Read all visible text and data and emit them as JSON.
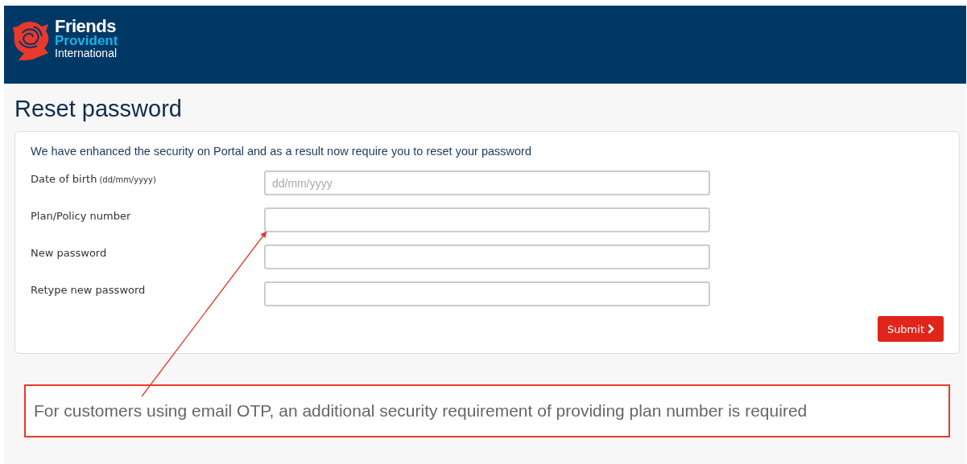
{
  "header": {
    "logo": {
      "line_1": "Friends",
      "line_2": "Provident",
      "line_3": "International"
    }
  },
  "page_title": "Reset password",
  "form": {
    "intro": "We have enhanced the security on Portal and as a result now require you to reset your password",
    "fields": [
      {
        "label": "Date of birth",
        "hint": "(dd/mm/yyyy)",
        "placeholder": "dd/mm/yyyy"
      },
      {
        "label": "Plan/Policy number"
      },
      {
        "label": "New password"
      },
      {
        "label": "Retype new password"
      }
    ],
    "submit": "Submit"
  },
  "annotation": {
    "text": "For customers using email OTP, an additional security requirement of providing plan number is required"
  }
}
